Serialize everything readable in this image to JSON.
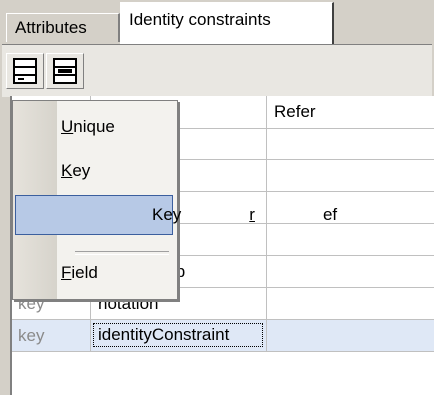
{
  "tabs": [
    {
      "label": "Attributes",
      "active": false
    },
    {
      "label": "Identity constraints",
      "active": true
    }
  ],
  "toolbar": {
    "buttons": [
      {
        "icon": "insert-row-icon"
      },
      {
        "icon": "append-row-icon"
      }
    ]
  },
  "grid": {
    "columns": [
      "",
      "",
      "Refer"
    ],
    "rows": [
      {
        "kind": "",
        "name": "",
        "refer": ""
      },
      {
        "kind": "",
        "name": "",
        "refer": ""
      },
      {
        "kind": "",
        "name": "",
        "refer": ""
      },
      {
        "kind": "",
        "name": "",
        "refer": ""
      },
      {
        "kind": "",
        "name": "Group",
        "refer": ""
      },
      {
        "kind": "key",
        "name": "notation",
        "refer": ""
      },
      {
        "kind": "key",
        "name": "identityConstraint",
        "refer": "",
        "selected": true
      }
    ]
  },
  "context_menu": {
    "items": [
      {
        "pre": "",
        "mn": "U",
        "post": "nique"
      },
      {
        "pre": "",
        "mn": "K",
        "post": "ey"
      },
      {
        "pre": "Key",
        "mn": "r",
        "post": "ef",
        "highlighted": true
      },
      {
        "pre": "",
        "mn": "F",
        "post": "ield"
      }
    ]
  },
  "colors": {
    "menu_highlight": "#b7c9e6",
    "row_selected": "#dfe8f6",
    "window_face": "#d4d0c8"
  }
}
